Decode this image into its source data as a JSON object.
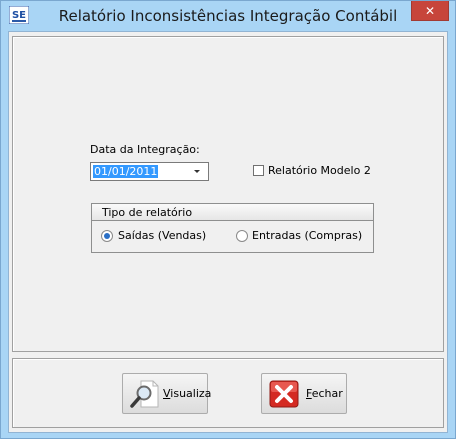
{
  "window": {
    "title": "Relatório Inconsistências Integração Contábil",
    "app_icon_text": "SE",
    "close_symbol": "✕"
  },
  "form": {
    "date_label": "Data da Integração:",
    "date_value": "01/01/2011",
    "model2_label": "Relatório Modelo 2",
    "model2_checked": false
  },
  "report_type": {
    "title": "Tipo de relatório",
    "options": [
      {
        "label": "Saídas (Vendas)",
        "selected": true
      },
      {
        "label": "Entradas (Compras)",
        "selected": false
      }
    ]
  },
  "buttons": {
    "visualiza": {
      "accel": "V",
      "rest": "isualiza"
    },
    "fechar": {
      "accel": "F",
      "rest": "echar"
    }
  },
  "colors": {
    "frame": "#a9d5f5",
    "close": "#c7453b",
    "selection": "#3399ff",
    "face": "#f0f0f0"
  }
}
